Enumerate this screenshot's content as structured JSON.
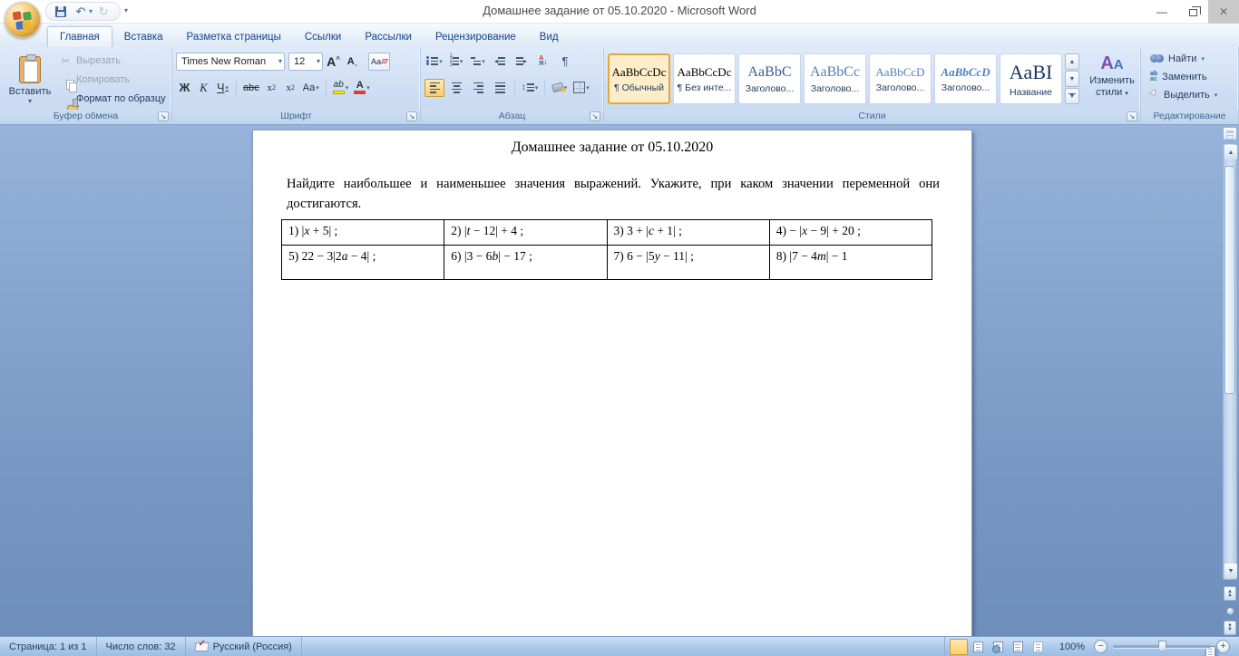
{
  "titlebar": {
    "title": "Домашнее задание от 05.10.2020 - Microsoft Word"
  },
  "tabs": [
    {
      "label": "Главная",
      "active": true
    },
    {
      "label": "Вставка",
      "active": false
    },
    {
      "label": "Разметка страницы",
      "active": false
    },
    {
      "label": "Ссылки",
      "active": false
    },
    {
      "label": "Рассылки",
      "active": false
    },
    {
      "label": "Рецензирование",
      "active": false
    },
    {
      "label": "Вид",
      "active": false
    }
  ],
  "ribbon": {
    "clipboard": {
      "group_label": "Буфер обмена",
      "paste": "Вставить",
      "cut": "Вырезать",
      "copy": "Копировать",
      "format_painter": "Формат по образцу"
    },
    "font": {
      "group_label": "Шрифт",
      "family": "Times New Roman",
      "size": "12",
      "bold": "Ж",
      "italic": "К",
      "underline": "Ч",
      "strike": "abc",
      "case": "Aa"
    },
    "paragraph": {
      "group_label": "Абзац",
      "sort_a": "А",
      "sort_ya": "Я"
    },
    "styles": {
      "group_label": "Стили",
      "change_styles_line1": "Изменить",
      "change_styles_line2": "стили",
      "items": [
        {
          "preview": "AaBbCcDc",
          "label": "¶ Обычный",
          "color": "#000000",
          "size": "sm",
          "italic": false,
          "selected": true
        },
        {
          "preview": "AaBbCcDc",
          "label": "¶ Без инте...",
          "color": "#000000",
          "size": "sm",
          "italic": false,
          "selected": false
        },
        {
          "preview": "AaBbC",
          "label": "Заголово...",
          "color": "#365f91",
          "size": "lg",
          "italic": false,
          "selected": false
        },
        {
          "preview": "AaBbCc",
          "label": "Заголово...",
          "color": "#4f81bd",
          "size": "lg",
          "italic": false,
          "selected": false
        },
        {
          "preview": "AaBbCcD",
          "label": "Заголово...",
          "color": "#4f81bd",
          "size": "sm",
          "italic": false,
          "selected": false
        },
        {
          "preview": "AaBbCcD",
          "label": "Заголово...",
          "color": "#4f81bd",
          "size": "sm",
          "italic": true,
          "selected": false
        },
        {
          "preview": "AaBI",
          "label": "Название",
          "color": "#17365d",
          "size": "xl",
          "italic": false,
          "selected": false
        }
      ]
    },
    "editing": {
      "group_label": "Редактирование",
      "find": "Найти",
      "replace": "Заменить",
      "select": "Выделить"
    }
  },
  "document": {
    "title": "Домашнее задание от 05.10.2020",
    "body": "Найдите наибольшее и наименьшее значения выражений. Укажите, при каком значении переменной они достигаются.",
    "table_cells": [
      "1) |*x* + 5| ;",
      "2) |*t* − 12| + 4 ;",
      "3) 3 + |*c* + 1| ;",
      "4) − |*x* − 9| + 20 ;",
      "5) 22 − 3|2*a* − 4| ;",
      "6) |3 − 6*b*| − 17 ;",
      "7) 6 − |5*y* − 11| ;",
      "8) |7 − 4*m*| − 1"
    ]
  },
  "statusbar": {
    "page": "Страница: 1 из 1",
    "words": "Число слов: 32",
    "language": "Русский (Россия)",
    "zoom": "100%",
    "view_buttons": [
      "print-layout",
      "full-screen-reading",
      "web-layout",
      "outline",
      "draft"
    ]
  },
  "colors": {
    "selection_orange": "#fbd06b",
    "heading_blue": "#4f81bd",
    "doc_bg_top": "#97b3db",
    "doc_bg_bottom": "#6e8ebb"
  }
}
